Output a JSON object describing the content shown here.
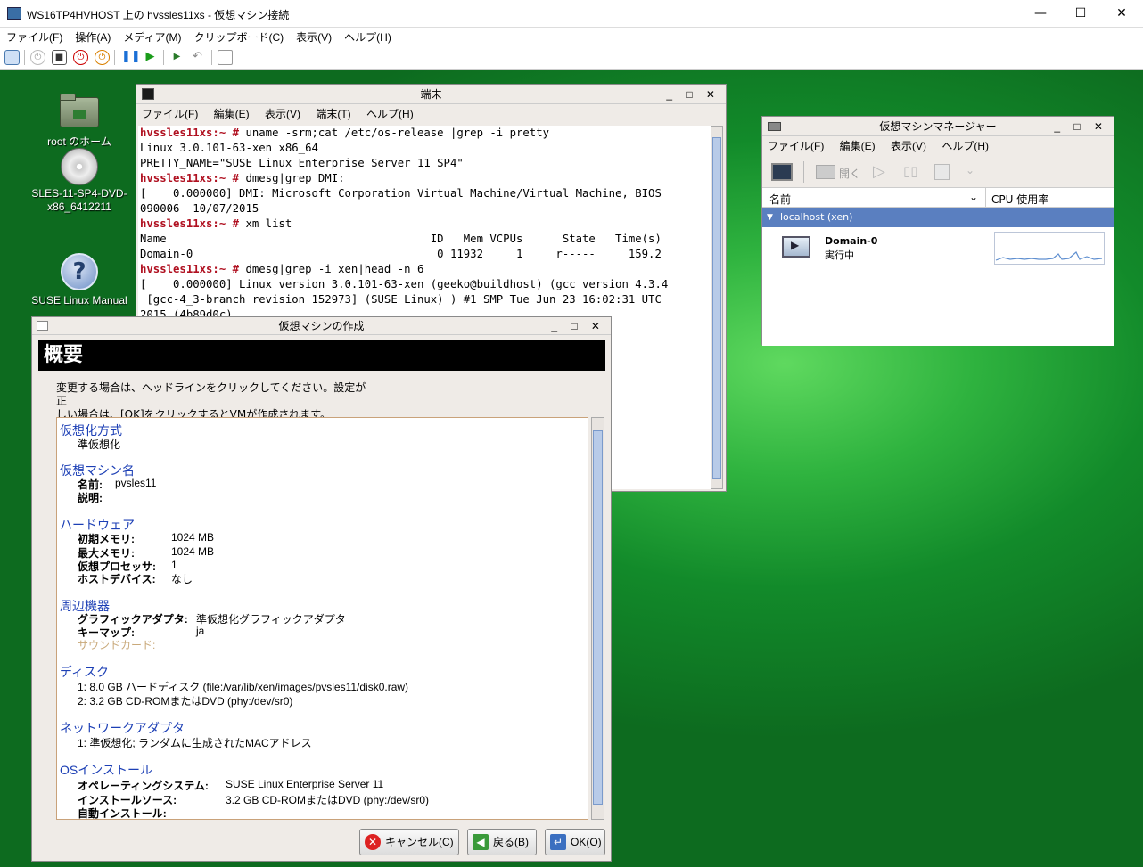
{
  "host": {
    "title": "WS16TP4HVHOST 上の hvssles11xs - 仮想マシン接続",
    "menu": [
      "ファイル(F)",
      "操作(A)",
      "メディア(M)",
      "クリップボード(C)",
      "表示(V)",
      "ヘルプ(H)"
    ],
    "controls": {
      "minimize": "—",
      "maximize": "☐",
      "close": "✕"
    }
  },
  "desktop": {
    "icons": [
      {
        "label": "root のホーム",
        "icon": "home-folder-icon"
      },
      {
        "label": "SLES-11-SP4-DVD-\nx86_6412211",
        "icon": "dvd-icon"
      },
      {
        "label": "SUSE Linux Manual",
        "icon": "help-icon"
      }
    ]
  },
  "terminal": {
    "title": "端末",
    "menu": [
      "ファイル(F)",
      "編集(E)",
      "表示(V)",
      "端末(T)",
      "ヘルプ(H)"
    ],
    "lines": [
      {
        "prompt": "hvssles11xs:~ #",
        "text": " uname -srm;cat /etc/os-release |grep -i pretty"
      },
      {
        "prompt": "",
        "text": "Linux 3.0.101-63-xen x86_64"
      },
      {
        "prompt": "",
        "text": "PRETTY_NAME=\"SUSE Linux Enterprise Server 11 SP4\""
      },
      {
        "prompt": "hvssles11xs:~ #",
        "text": " dmesg|grep DMI:"
      },
      {
        "prompt": "",
        "text": "[    0.000000] DMI: Microsoft Corporation Virtual Machine/Virtual Machine, BIOS"
      },
      {
        "prompt": "",
        "text": "090006  10/07/2015"
      },
      {
        "prompt": "hvssles11xs:~ #",
        "text": " xm list"
      },
      {
        "prompt": "",
        "text": "Name                                        ID   Mem VCPUs      State   Time(s)"
      },
      {
        "prompt": "",
        "text": "Domain-0                                     0 11932     1     r-----     159.2"
      },
      {
        "prompt": "hvssles11xs:~ #",
        "text": " dmesg|grep -i xen|head -n 6"
      },
      {
        "prompt": "",
        "text": "[    0.000000] Linux version 3.0.101-63-xen (geeko@buildhost) (gcc version 4.3.4"
      },
      {
        "prompt": "",
        "text": " [gcc-4_3-branch revision 152973] (SUSE Linux) ) #1 SMP Tue Jun 23 16:02:31 UTC"
      },
      {
        "prompt": "",
        "text": "2015 (4b89d0c)"
      }
    ]
  },
  "vmm": {
    "title": "仮想マシンマネージャー",
    "menu": [
      "ファイル(F)",
      "編集(E)",
      "表示(V)",
      "ヘルプ(H)"
    ],
    "toolbar_open": "開く",
    "col_name": "名前",
    "col_cpu": "CPU 使用率",
    "group": "localhost (xen)",
    "vm_name": "Domain-0",
    "vm_state": "実行中"
  },
  "dialog": {
    "title": "仮想マシンの作成",
    "header": "概要",
    "intro1": "変更する場合は、ヘッドラインをクリックしてください。設定が正",
    "intro2": "しい場合は、[OK]をクリックするとVMが作成されます。",
    "sections": {
      "virt": {
        "title": "仮想化方式",
        "value": "準仮想化"
      },
      "name": {
        "title": "仮想マシン名",
        "name_label": "名前:",
        "name_value": "pvsles11",
        "desc_label": "説明:"
      },
      "hw": {
        "title": "ハードウェア",
        "rows": [
          {
            "label": "初期メモリ:",
            "value": "1024 MB"
          },
          {
            "label": "最大メモリ:",
            "value": "1024 MB"
          },
          {
            "label": "仮想プロセッサ:",
            "value": "1"
          },
          {
            "label": "ホストデバイス:",
            "value": "なし"
          }
        ]
      },
      "periph": {
        "title": "周辺機器",
        "gfx_label": "グラフィックアダプタ:",
        "gfx_value": "準仮想化グラフィックアダプタ",
        "key_label": "キーマップ:",
        "key_value": "ja",
        "sound_label": "サウンドカード:"
      },
      "disk": {
        "title": "ディスク",
        "d1": "1: 8.0 GB ハードディスク (file:/var/lib/xen/images/pvsles11/disk0.raw)",
        "d2": "2: 3.2 GB CD-ROMまたはDVD (phy:/dev/sr0)"
      },
      "net": {
        "title": "ネットワークアダプタ",
        "n1": "1: 準仮想化; ランダムに生成されたMACアドレス"
      },
      "os": {
        "title": "OSインストール",
        "os_label": "オペレーティングシステム:",
        "os_value": "SUSE Linux Enterprise Server 11",
        "src_label": "インストールソース:",
        "src_value": "3.2 GB CD-ROMまたはDVD (phy:/dev/sr0)",
        "auto_label": "自動インストール:"
      }
    },
    "buttons": {
      "cancel": "キャンセル(C)",
      "back": "戻る(B)",
      "ok": "OK(O)"
    }
  }
}
